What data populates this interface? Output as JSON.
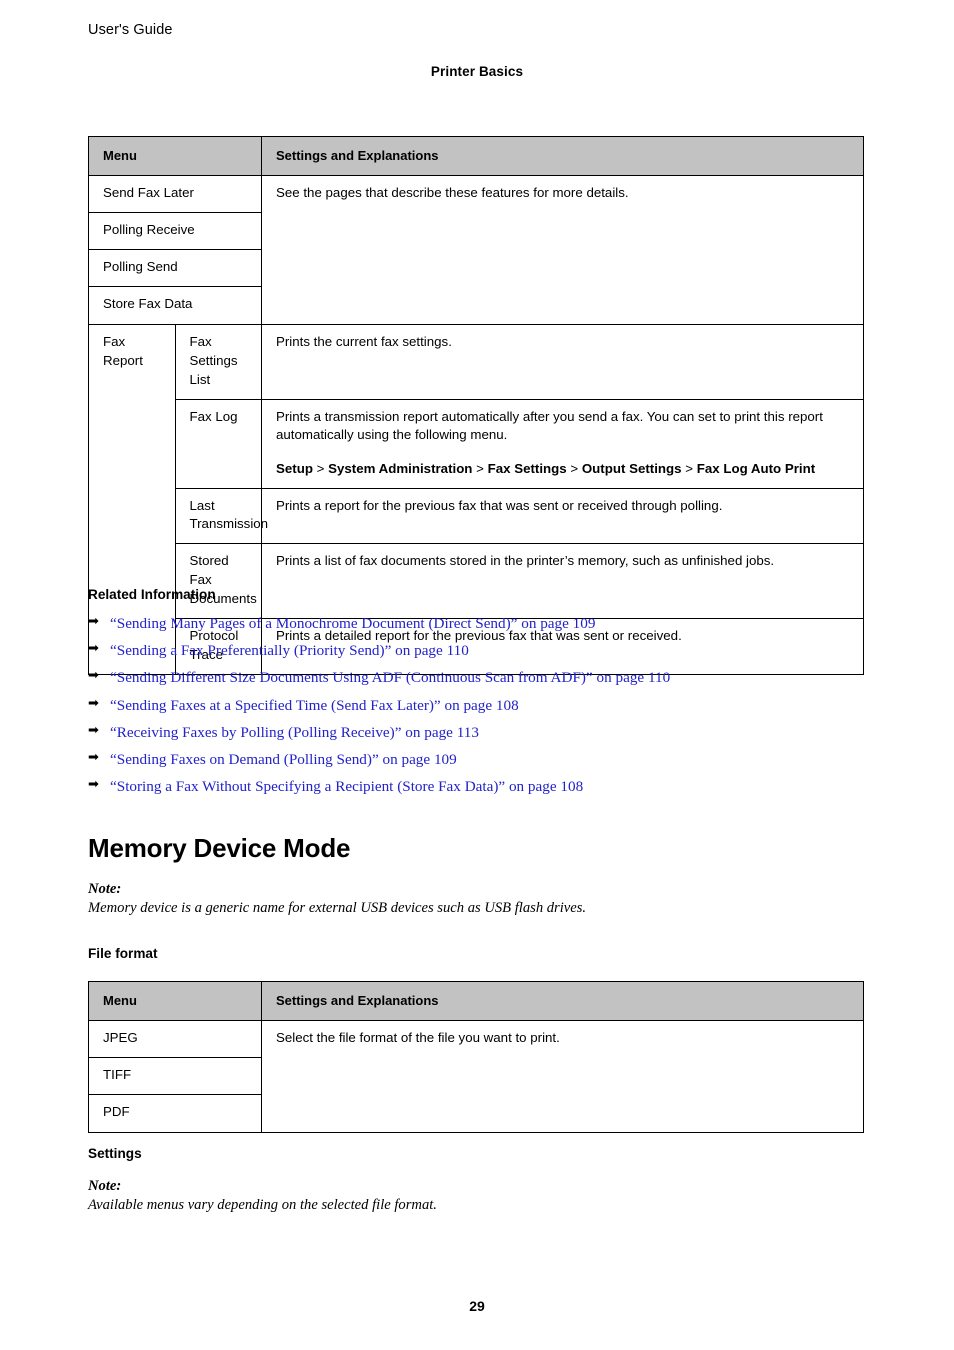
{
  "header": {
    "running_head": "User's Guide",
    "chapter": "Printer Basics"
  },
  "fax_table": {
    "columns": [
      "Menu",
      "Settings and Explanations"
    ],
    "grouped_rows": {
      "menus": [
        "Send Fax Later",
        "Polling Receive",
        "Polling Send",
        "Store Fax Data"
      ],
      "description": "See the pages that describe these features for more details."
    },
    "fax_report": {
      "label": "Fax Report",
      "rows": [
        {
          "name": "Fax Settings List",
          "description": "Prints the current fax settings."
        },
        {
          "name": "Fax Log",
          "description": "Prints a transmission report automatically after you send a fax. You can set to print this report automatically using the following menu.",
          "menu_path": [
            "Setup",
            "System Administration",
            "Fax Settings",
            "Output Settings",
            "Fax Log Auto Print"
          ],
          "menu_path_separator": ">"
        },
        {
          "name": "Last Transmission",
          "description": "Prints a report for the previous fax that was sent or received through polling."
        },
        {
          "name": "Stored Fax Documents",
          "description": "Prints a list of fax documents stored in the printer’s memory, such as unfinished jobs."
        },
        {
          "name": "Protocol Trace",
          "description": "Prints a detailed report for the previous fax that was sent or received."
        }
      ]
    }
  },
  "related_information": {
    "title": "Related Information",
    "bullet_icon": "arrow-right-icon",
    "links": [
      "“Sending Many Pages of a Monochrome Document (Direct Send)” on page 109",
      "“Sending a Fax Preferentially (Priority Send)” on page 110",
      "“Sending Different Size Documents Using ADF (Continuous Scan from ADF)” on page 110",
      "“Sending Faxes at a Specified Time (Send Fax Later)” on page 108",
      "“Receiving Faxes by Polling (Polling Receive)” on page 113",
      "“Sending Faxes on Demand (Polling Send)” on page 109",
      "“Storing a Fax Without Specifying a Recipient (Store Fax Data)” on page 108"
    ],
    "link_color": "#2222cc"
  },
  "memory_device_mode": {
    "title": "Memory Device Mode",
    "note": {
      "label": "Note:",
      "text": "Memory device is a generic name for external USB devices such as USB flash drives."
    },
    "file_format": {
      "heading": "File format",
      "columns": [
        "Menu",
        "Settings and Explanations"
      ],
      "menus": [
        "JPEG",
        "TIFF",
        "PDF"
      ],
      "description": "Select the file format of the file you want to print."
    },
    "settings": {
      "heading": "Settings",
      "note": {
        "label": "Note:",
        "text": "Available menus vary depending on the selected file format."
      }
    }
  },
  "footer": {
    "page_number": "29"
  }
}
